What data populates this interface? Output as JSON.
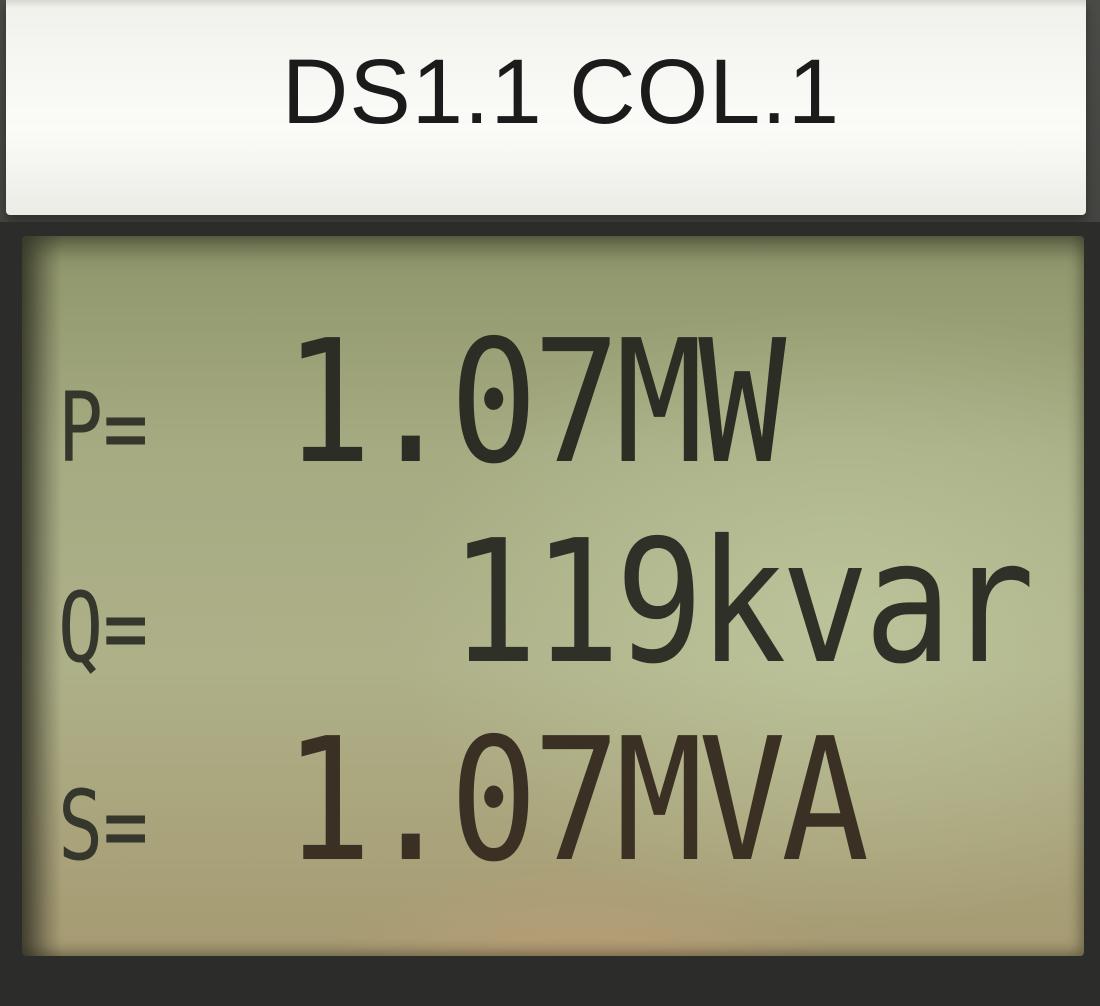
{
  "label": {
    "text": "DS1.1 COL.1"
  },
  "display": {
    "rows": [
      {
        "label": "P=",
        "value": "1.07MW"
      },
      {
        "label": "Q=",
        "value": "  119kvar"
      },
      {
        "label": "S=",
        "value": "1.07MVA"
      }
    ]
  },
  "colors": {
    "lcd_background": "#a6ab82",
    "lcd_text": "#2d2e25",
    "label_background": "#f6f6f2",
    "label_text": "#1b1b1b"
  }
}
